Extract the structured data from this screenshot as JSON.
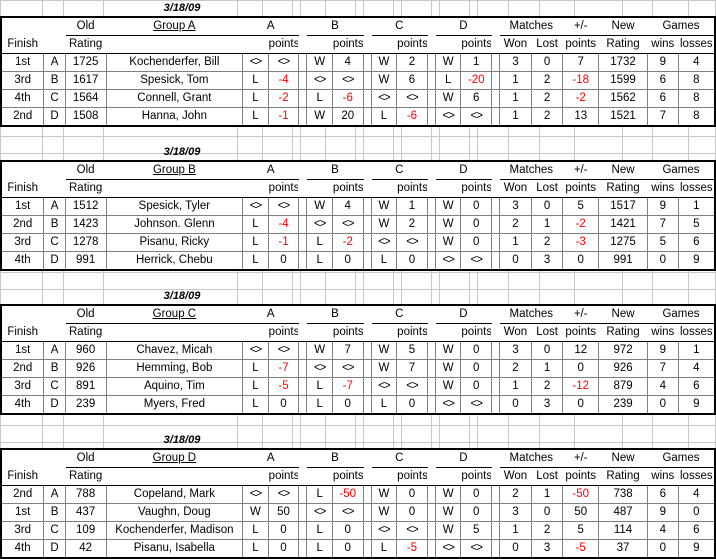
{
  "colors": {
    "separator_purple": "#cc99ff",
    "self_cell_gray": "#c0c0c0",
    "negative_text": "#ff0000",
    "grid_line": "#808080",
    "sheet_grid": "#c8c8c8"
  },
  "glyphs": {
    "self_marker": "<>"
  },
  "headers": {
    "finish": "Finish",
    "seed": "",
    "old": "Old",
    "rating": "Rating",
    "name": "",
    "opp_a": "A",
    "opp_b": "B",
    "opp_c": "C",
    "opp_d": "D",
    "points": "points",
    "blank": "",
    "matches": "Matches",
    "won": "Won",
    "lost": "Lost",
    "plusminus": "+/-",
    "plusminus_points": "points",
    "new": "New",
    "new_rating": "Rating",
    "games": "Games",
    "wins": "wins",
    "losses": "losses"
  },
  "tables": [
    {
      "date": "3/18/09",
      "group_title": "Group A",
      "rows": [
        {
          "finish": "1st",
          "seed": "A",
          "old_rating": "1725",
          "name": "Kochenderfer, Bill",
          "matches": [
            {
              "result": "<>",
              "points": "<>",
              "self": true
            },
            {
              "result": "W",
              "points": "4",
              "self": false
            },
            {
              "result": "W",
              "points": "2",
              "self": false
            },
            {
              "result": "W",
              "points": "1",
              "self": false
            }
          ],
          "won": "3",
          "lost": "0",
          "plusminus": "7",
          "new_rating": "1732",
          "wins": "9",
          "losses": "4"
        },
        {
          "finish": "3rd",
          "seed": "B",
          "old_rating": "1617",
          "name": "Spesick, Tom",
          "matches": [
            {
              "result": "L",
              "points": "-4",
              "self": false
            },
            {
              "result": "<>",
              "points": "<>",
              "self": true
            },
            {
              "result": "W",
              "points": "6",
              "self": false
            },
            {
              "result": "L",
              "points": "-20",
              "self": false
            }
          ],
          "won": "1",
          "lost": "2",
          "plusminus": "-18",
          "new_rating": "1599",
          "wins": "6",
          "losses": "8"
        },
        {
          "finish": "4th",
          "seed": "C",
          "old_rating": "1564",
          "name": "Connell, Grant",
          "matches": [
            {
              "result": "L",
              "points": "-2",
              "self": false
            },
            {
              "result": "L",
              "points": "-6",
              "self": false
            },
            {
              "result": "<>",
              "points": "<>",
              "self": true
            },
            {
              "result": "W",
              "points": "6",
              "self": false
            }
          ],
          "won": "1",
          "lost": "2",
          "plusminus": "-2",
          "new_rating": "1562",
          "wins": "6",
          "losses": "8"
        },
        {
          "finish": "2nd",
          "seed": "D",
          "old_rating": "1508",
          "name": "Hanna, John",
          "matches": [
            {
              "result": "L",
              "points": "-1",
              "self": false
            },
            {
              "result": "W",
              "points": "20",
              "self": false
            },
            {
              "result": "L",
              "points": "-6",
              "self": false
            },
            {
              "result": "<>",
              "points": "<>",
              "self": true
            }
          ],
          "won": "1",
          "lost": "2",
          "plusminus": "13",
          "new_rating": "1521",
          "wins": "7",
          "losses": "8"
        }
      ]
    },
    {
      "date": "3/18/09",
      "group_title": "Group B",
      "rows": [
        {
          "finish": "1st",
          "seed": "A",
          "old_rating": "1512",
          "name": "Spesick, Tyler",
          "matches": [
            {
              "result": "<>",
              "points": "<>",
              "self": true
            },
            {
              "result": "W",
              "points": "4",
              "self": false
            },
            {
              "result": "W",
              "points": "1",
              "self": false
            },
            {
              "result": "W",
              "points": "0",
              "self": false
            }
          ],
          "won": "3",
          "lost": "0",
          "plusminus": "5",
          "new_rating": "1517",
          "wins": "9",
          "losses": "1"
        },
        {
          "finish": "2nd",
          "seed": "B",
          "old_rating": "1423",
          "name": "Johnson. Glenn",
          "matches": [
            {
              "result": "L",
              "points": "-4",
              "self": false
            },
            {
              "result": "<>",
              "points": "<>",
              "self": true
            },
            {
              "result": "W",
              "points": "2",
              "self": false
            },
            {
              "result": "W",
              "points": "0",
              "self": false
            }
          ],
          "won": "2",
          "lost": "1",
          "plusminus": "-2",
          "new_rating": "1421",
          "wins": "7",
          "losses": "5"
        },
        {
          "finish": "3rd",
          "seed": "C",
          "old_rating": "1278",
          "name": "Pisanu, Ricky",
          "matches": [
            {
              "result": "L",
              "points": "-1",
              "self": false
            },
            {
              "result": "L",
              "points": "-2",
              "self": false
            },
            {
              "result": "<>",
              "points": "<>",
              "self": true
            },
            {
              "result": "W",
              "points": "0",
              "self": false
            }
          ],
          "won": "1",
          "lost": "2",
          "plusminus": "-3",
          "new_rating": "1275",
          "wins": "5",
          "losses": "6"
        },
        {
          "finish": "4th",
          "seed": "D",
          "old_rating": "991",
          "name": "Herrick, Chebu",
          "matches": [
            {
              "result": "L",
              "points": "0",
              "self": false
            },
            {
              "result": "L",
              "points": "0",
              "self": false
            },
            {
              "result": "L",
              "points": "0",
              "self": false
            },
            {
              "result": "<>",
              "points": "<>",
              "self": true
            }
          ],
          "won": "0",
          "lost": "3",
          "plusminus": "0",
          "new_rating": "991",
          "wins": "0",
          "losses": "9"
        }
      ]
    },
    {
      "date": "3/18/09",
      "group_title": "Group C",
      "rows": [
        {
          "finish": "1st",
          "seed": "A",
          "old_rating": "960",
          "name": "Chavez, Micah",
          "matches": [
            {
              "result": "<>",
              "points": "<>",
              "self": true
            },
            {
              "result": "W",
              "points": "7",
              "self": false
            },
            {
              "result": "W",
              "points": "5",
              "self": false
            },
            {
              "result": "W",
              "points": "0",
              "self": false
            }
          ],
          "won": "3",
          "lost": "0",
          "plusminus": "12",
          "new_rating": "972",
          "wins": "9",
          "losses": "1"
        },
        {
          "finish": "2nd",
          "seed": "B",
          "old_rating": "926",
          "name": "Hemming, Bob",
          "matches": [
            {
              "result": "L",
              "points": "-7",
              "self": false
            },
            {
              "result": "<>",
              "points": "<>",
              "self": true
            },
            {
              "result": "W",
              "points": "7",
              "self": false
            },
            {
              "result": "W",
              "points": "0",
              "self": false
            }
          ],
          "won": "2",
          "lost": "1",
          "plusminus": "0",
          "new_rating": "926",
          "wins": "7",
          "losses": "4"
        },
        {
          "finish": "3rd",
          "seed": "C",
          "old_rating": "891",
          "name": "Aquino, Tim",
          "matches": [
            {
              "result": "L",
              "points": "-5",
              "self": false
            },
            {
              "result": "L",
              "points": "-7",
              "self": false
            },
            {
              "result": "<>",
              "points": "<>",
              "self": true
            },
            {
              "result": "W",
              "points": "0",
              "self": false
            }
          ],
          "won": "1",
          "lost": "2",
          "plusminus": "-12",
          "new_rating": "879",
          "wins": "4",
          "losses": "6"
        },
        {
          "finish": "4th",
          "seed": "D",
          "old_rating": "239",
          "name": "Myers, Fred",
          "matches": [
            {
              "result": "L",
              "points": "0",
              "self": false
            },
            {
              "result": "L",
              "points": "0",
              "self": false
            },
            {
              "result": "L",
              "points": "0",
              "self": false
            },
            {
              "result": "<>",
              "points": "<>",
              "self": true
            }
          ],
          "won": "0",
          "lost": "3",
          "plusminus": "0",
          "new_rating": "239",
          "wins": "0",
          "losses": "9"
        }
      ]
    },
    {
      "date": "3/18/09",
      "group_title": "Group D",
      "rows": [
        {
          "finish": "2nd",
          "seed": "A",
          "old_rating": "788",
          "name": "Copeland, Mark",
          "matches": [
            {
              "result": "<>",
              "points": "<>",
              "self": true
            },
            {
              "result": "L",
              "points": "-50",
              "self": false
            },
            {
              "result": "W",
              "points": "0",
              "self": false
            },
            {
              "result": "W",
              "points": "0",
              "self": false
            }
          ],
          "won": "2",
          "lost": "1",
          "plusminus": "-50",
          "new_rating": "738",
          "wins": "6",
          "losses": "4"
        },
        {
          "finish": "1st",
          "seed": "B",
          "old_rating": "437",
          "name": "Vaughn, Doug",
          "matches": [
            {
              "result": "W",
              "points": "50",
              "self": false
            },
            {
              "result": "<>",
              "points": "<>",
              "self": true
            },
            {
              "result": "W",
              "points": "0",
              "self": false
            },
            {
              "result": "W",
              "points": "0",
              "self": false
            }
          ],
          "won": "3",
          "lost": "0",
          "plusminus": "50",
          "new_rating": "487",
          "wins": "9",
          "losses": "0"
        },
        {
          "finish": "3rd",
          "seed": "C",
          "old_rating": "109",
          "name": "Kochenderfer, Madison",
          "matches": [
            {
              "result": "L",
              "points": "0",
              "self": false
            },
            {
              "result": "L",
              "points": "0",
              "self": false
            },
            {
              "result": "<>",
              "points": "<>",
              "self": true
            },
            {
              "result": "W",
              "points": "5",
              "self": false
            }
          ],
          "won": "1",
          "lost": "2",
          "plusminus": "5",
          "new_rating": "114",
          "wins": "4",
          "losses": "6"
        },
        {
          "finish": "4th",
          "seed": "D",
          "old_rating": "42",
          "name": "Pisanu, Isabella",
          "matches": [
            {
              "result": "L",
              "points": "0",
              "self": false
            },
            {
              "result": "L",
              "points": "0",
              "self": false
            },
            {
              "result": "L",
              "points": "-5",
              "self": false
            },
            {
              "result": "<>",
              "points": "<>",
              "self": true
            }
          ],
          "won": "0",
          "lost": "3",
          "plusminus": "-5",
          "new_rating": "37",
          "wins": "0",
          "losses": "9"
        }
      ]
    }
  ]
}
